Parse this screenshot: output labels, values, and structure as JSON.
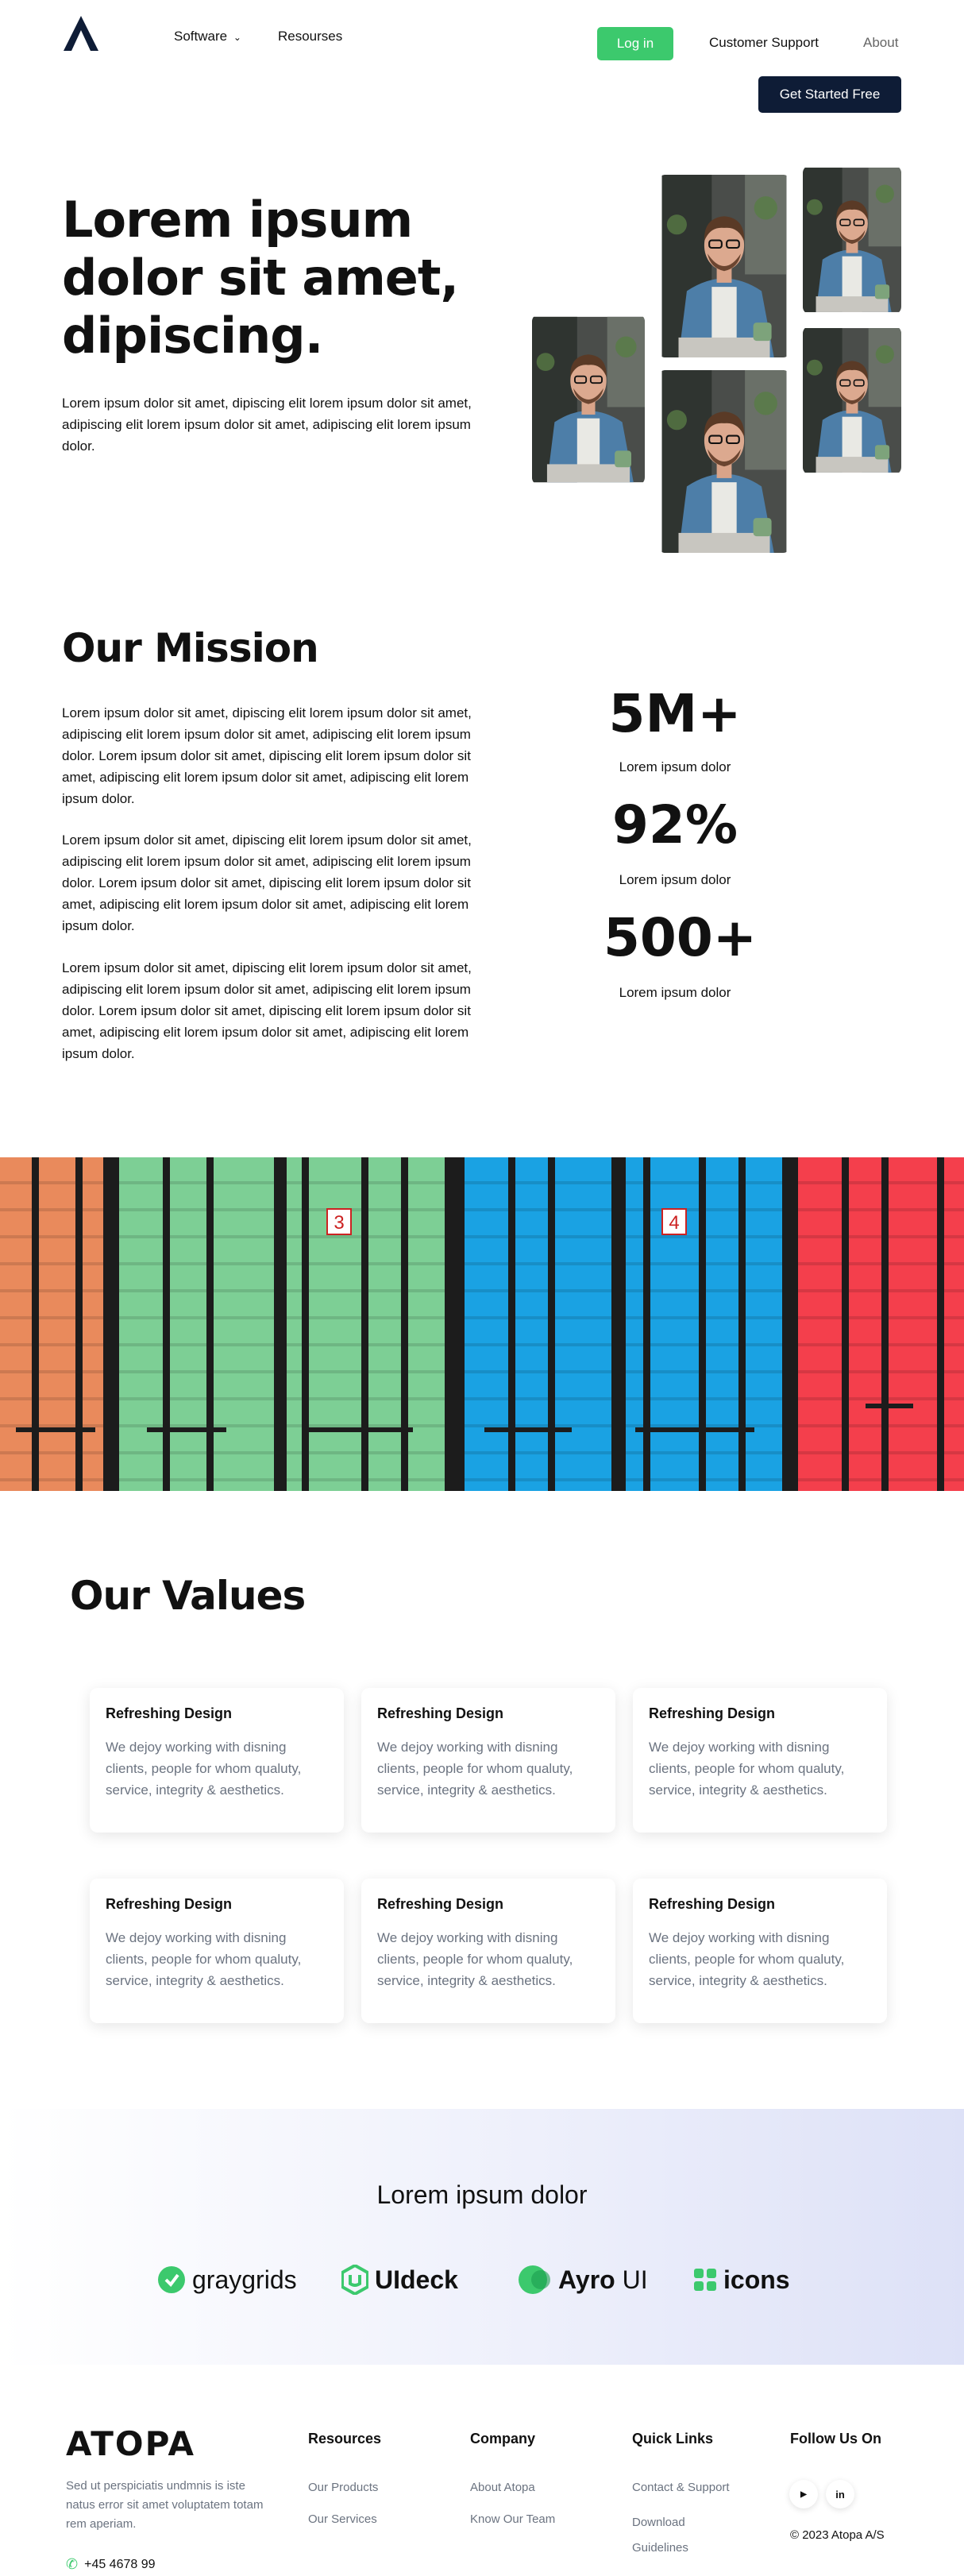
{
  "header": {
    "nav": [
      {
        "label": "Software",
        "has_dropdown": true
      },
      {
        "label": "Resourses",
        "has_dropdown": false
      }
    ],
    "login_label": "Log in",
    "customer_support_label": "Customer Support",
    "about_label": "About",
    "get_started_label": "Get Started Free",
    "accent_color": "#3cc96d",
    "dark_color": "#0e1c36"
  },
  "hero": {
    "title_lines": [
      "Lorem ipsum",
      "dolor sit amet,",
      "dipiscing."
    ],
    "text": "Lorem ipsum dolor sit amet, dipiscing elit lorem ipsum dolor sit amet, adipiscing elit lorem ipsum dolor sit amet, adipiscing elit lorem ipsum dolor."
  },
  "mission": {
    "title": "Our Mission",
    "paragraphs": [
      "Lorem ipsum dolor sit amet, dipiscing elit lorem ipsum dolor sit amet, adipiscing elit lorem ipsum dolor sit amet, adipiscing elit lorem ipsum dolor. Lorem ipsum dolor sit amet, dipiscing elit lorem ipsum dolor sit amet, adipiscing elit lorem ipsum dolor sit amet, adipiscing elit lorem ipsum dolor.",
      "Lorem ipsum dolor sit amet, dipiscing elit lorem ipsum dolor sit amet, adipiscing elit lorem ipsum dolor sit amet, adipiscing elit lorem ipsum dolor. Lorem ipsum dolor sit amet, dipiscing elit lorem ipsum dolor sit amet, adipiscing elit lorem ipsum dolor sit amet, adipiscing elit lorem ipsum dolor.",
      "Lorem ipsum dolor sit amet, dipiscing elit lorem ipsum dolor sit amet, adipiscing elit lorem ipsum dolor sit amet, adipiscing elit lorem ipsum dolor. Lorem ipsum dolor sit amet, dipiscing elit lorem ipsum dolor sit amet, adipiscing elit lorem ipsum dolor sit amet, adipiscing elit lorem ipsum dolor."
    ],
    "stats": [
      {
        "value": "5M+",
        "label": "Lorem ipsum dolor"
      },
      {
        "value": "92%",
        "label": "Lorem ipsum dolor"
      },
      {
        "value": "500+",
        "label": "Lorem ipsum dolor"
      }
    ]
  },
  "banner": {
    "container_numbers": [
      "3",
      "4"
    ],
    "colors": [
      "#e98a5c",
      "#7dcf95",
      "#1aa2e3",
      "#f43f4c"
    ]
  },
  "values": {
    "title": "Our Values",
    "cards": [
      {
        "title": "Refreshing Design",
        "text": "We dejoy working with disning clients, people for whom qualuty, service, integrity & aesthetics."
      },
      {
        "title": "Refreshing Design",
        "text": "We dejoy working with disning clients, people for whom qualuty, service, integrity & aesthetics."
      },
      {
        "title": "Refreshing Design",
        "text": "We dejoy working with disning clients, people for whom qualuty, service, integrity & aesthetics."
      },
      {
        "title": "Refreshing Design",
        "text": "We dejoy working with disning clients, people for whom qualuty, service, integrity & aesthetics."
      },
      {
        "title": "Refreshing Design",
        "text": "We dejoy working with disning clients, people for whom qualuty, service, integrity & aesthetics."
      },
      {
        "title": "Refreshing Design",
        "text": "We dejoy working with disning clients, people for whom qualuty, service, integrity & aesthetics."
      }
    ]
  },
  "partners": {
    "title": "Lorem ipsum dolor",
    "logos": [
      {
        "name": "graygrids",
        "icon": "graygrids-icon"
      },
      {
        "name": "UIdeck",
        "icon": "uideck-icon"
      },
      {
        "name": "Ayro",
        "suffix": "UI",
        "icon": "ayro-icon"
      },
      {
        "name": "icons",
        "icon": "icons-grid-icon"
      }
    ]
  },
  "footer": {
    "logo": "ATOPA",
    "description": "Sed ut perspiciatis undmnis is iste natus error sit amet voluptatem totam rem aperiam.",
    "phone": "+45 4678 99",
    "columns": [
      {
        "heading": "Resources",
        "links": [
          "Our Products",
          "Our Services"
        ]
      },
      {
        "heading": "Company",
        "links": [
          "About Atopa",
          "Know Our Team"
        ]
      },
      {
        "heading": "Quick Links",
        "links": [
          "Contact & Support",
          "Download Guidelines"
        ]
      }
    ],
    "follow_heading": "Follow Us On",
    "social": [
      {
        "icon": "youtube-icon",
        "glyph": "▶"
      },
      {
        "icon": "linkedin-icon",
        "glyph": "in"
      }
    ],
    "copyright": "© 2023 Atopa A/S"
  }
}
